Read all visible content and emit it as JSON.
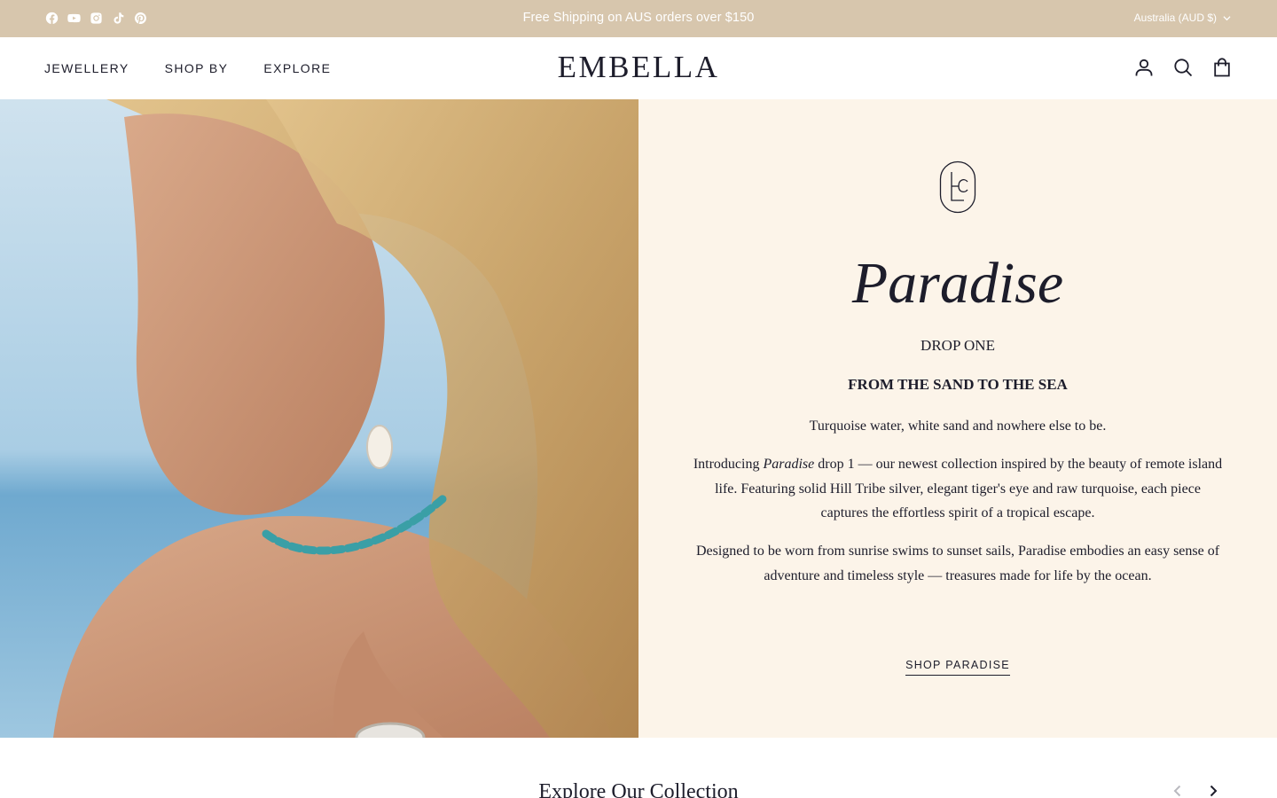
{
  "announcement": {
    "text": "Free Shipping on AUS orders over $150",
    "region": "Australia (AUD $)",
    "social_icons": [
      "facebook-icon",
      "youtube-icon",
      "instagram-icon",
      "tiktok-icon",
      "pinterest-icon"
    ]
  },
  "header": {
    "logo": "EMBELLA",
    "nav": [
      "JEWELLERY",
      "SHOP BY",
      "EXPLORE"
    ],
    "icons": [
      "account-icon",
      "search-icon",
      "cart-icon"
    ]
  },
  "hero": {
    "title": "Paradise",
    "drop": "DROP ONE",
    "subhead": "FROM THE SAND TO THE SEA",
    "para1": "Turquoise water, white sand and nowhere else to be.",
    "para2_pre": "Introducing ",
    "para2_em": "Paradise",
    "para2_post": " drop 1 — our newest collection inspired by the beauty of remote island life. Featuring solid Hill Tribe silver, elegant tiger's eye and raw turquoise, each piece captures the effortless spirit of a tropical escape.",
    "para3": "Designed to be worn from sunrise swims to sunset sails, Paradise embodies an easy sense of adventure and timeless style — treasures made for life by the ocean.",
    "cta": "SHOP PARADISE"
  },
  "collection": {
    "title": "Explore Our Collection"
  },
  "colors": {
    "announce_bg": "#d7c6ad",
    "panel_bg": "#fcf4e9",
    "text": "#1d1d2b"
  }
}
